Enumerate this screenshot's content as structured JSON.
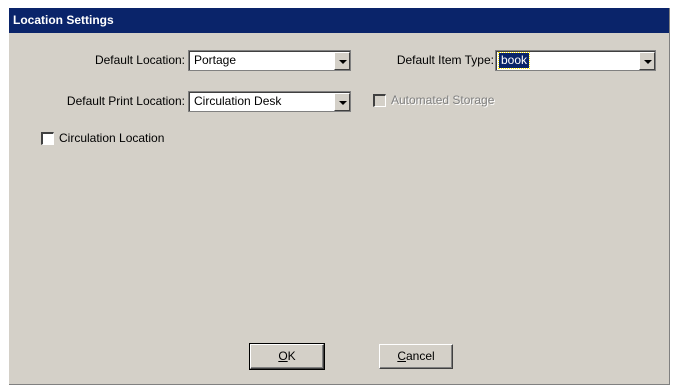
{
  "window": {
    "title": "Location Settings"
  },
  "fields": {
    "default_location": {
      "label": "Default Location:",
      "value": "Portage"
    },
    "default_print_location": {
      "label": "Default Print Location:",
      "value": "Circulation Desk"
    },
    "default_item_type": {
      "label": "Default Item Type:",
      "value": "book"
    }
  },
  "checkboxes": {
    "circulation_location": {
      "label": "Circulation Location",
      "checked": false
    },
    "automated_storage": {
      "label": "Automated Storage",
      "checked": false,
      "disabled": true
    }
  },
  "buttons": {
    "ok": {
      "label": "OK",
      "mnemonic": "O"
    },
    "cancel": {
      "label": "Cancel",
      "mnemonic": "C"
    }
  }
}
